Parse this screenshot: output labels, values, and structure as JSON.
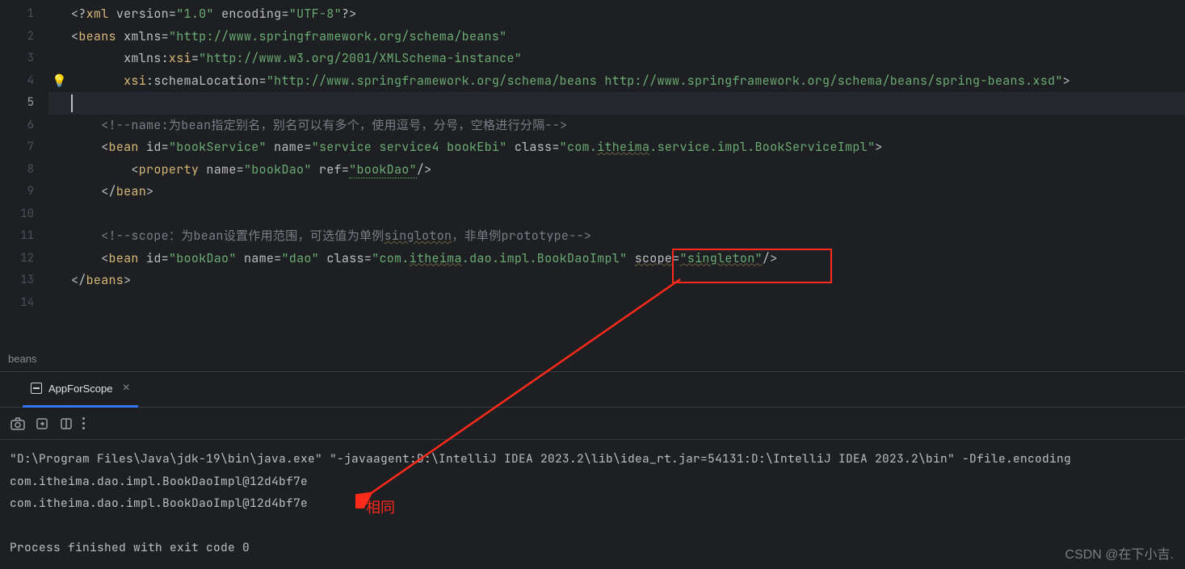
{
  "gutter": {
    "lines": [
      "1",
      "2",
      "3",
      "4",
      "5",
      "6",
      "7",
      "8",
      "9",
      "10",
      "11",
      "12",
      "13",
      "14"
    ]
  },
  "code": {
    "l1_pre": "<?",
    "l1_xml": "xml ",
    "l1_ver_attr": "version",
    "l1_eq": "=",
    "l1_ver_val": "\"1.0\"",
    "l1_sp": " ",
    "l1_enc_attr": "encoding",
    "l1_enc_val": "\"UTF-8\"",
    "l1_suf": "?>",
    "l2_open": "<",
    "l2_tag": "beans ",
    "l2_attr": "xmlns",
    "l2_val": "\"http://www.springframework.org/schema/beans\"",
    "l3_pad": "       ",
    "l3_ns": "xmlns:",
    "l3_xsi": "xsi",
    "l3_val": "\"http://www.w3.org/2001/XMLSchema-instance\"",
    "l4_pad": "       ",
    "l4_xsi": "xsi",
    "l4_colon": ":",
    "l4_attr": "schemaLocation",
    "l4_val": "\"http://www.springframework.org/schema/beans http://www.springframework.org/schema/beans/spring-beans.xsd\"",
    "l4_close": ">",
    "l6_pad": "    ",
    "l6_cmt": "<!--name:为bean指定别名，别名可以有多个，使用逗号，分号，空格进行分隔-->",
    "l7_pad": "    ",
    "l7_open": "<",
    "l7_tag": "bean ",
    "l7_id": "id",
    "l7_idv": "\"bookService\"",
    "l7_name": "name",
    "l7_namev": "\"service service4 bookEbi\"",
    "l7_class": "class",
    "l7_classv": "\"com.",
    "l7_ith": "itheima",
    "l7_classv2": ".service.impl.BookServiceImpl\"",
    "l7_close": ">",
    "l8_pad": "        ",
    "l8_open": "<",
    "l8_tag": "property ",
    "l8_name": "name",
    "l8_namev": "\"bookDao\"",
    "l8_ref": "ref",
    "l8_refv": "\"bookDao\"",
    "l8_close": "/>",
    "l9_pad": "    ",
    "l9_close": "</",
    "l9_tag": "bean",
    "l9_gt": ">",
    "l11_pad": "    ",
    "l11_cmt": "<!--scope：为bean设置作用范围，可选值为单例",
    "l11_sing": "singloton",
    "l11_cmt2": "，非单例prototype-->",
    "l12_pad": "    ",
    "l12_open": "<",
    "l12_tag": "bean ",
    "l12_id": "id",
    "l12_idv": "\"bookDao\"",
    "l12_name": "name",
    "l12_namev": "\"dao\"",
    "l12_class": "class",
    "l12_classv": "\"com.",
    "l12_ith": "itheima",
    "l12_classv2": ".dao.impl.BookDaoImpl\"",
    "l12_scope": "scope",
    "l12_scopev": "\"singleton\"",
    "l12_close": "/>",
    "l13_close": "</",
    "l13_tag": "beans",
    "l13_gt": ">"
  },
  "breadcrumb": "beans",
  "tab": {
    "label": "AppForScope"
  },
  "console": {
    "l1": "\"D:\\Program Files\\Java\\jdk-19\\bin\\java.exe\" \"-javaagent:D:\\IntelliJ IDEA 2023.2\\lib\\idea_rt.jar=54131:D:\\IntelliJ IDEA 2023.2\\bin\" -Dfile.encoding",
    "l2": "com.itheima.dao.impl.BookDaoImpl@12d4bf7e",
    "l3": "com.itheima.dao.impl.BookDaoImpl@12d4bf7e",
    "l5": "Process finished with exit code 0"
  },
  "annotation": {
    "label": "相同"
  },
  "watermark": "CSDN @在下小吉."
}
